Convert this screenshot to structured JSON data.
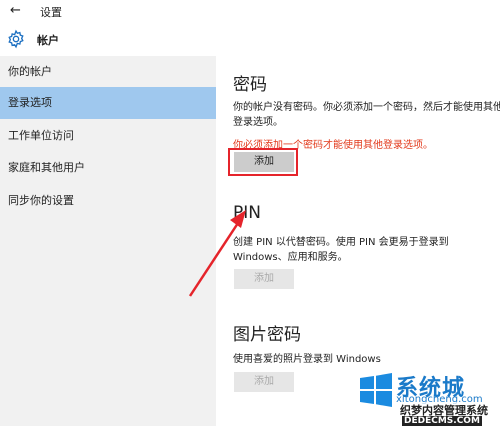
{
  "window": {
    "title": "设置",
    "back_glyph": "←"
  },
  "header": {
    "section_title": "帐户"
  },
  "sidebar": {
    "items": [
      {
        "label": "你的帐户"
      },
      {
        "label": "登录选项"
      },
      {
        "label": "工作单位访问"
      },
      {
        "label": "家庭和其他用户"
      },
      {
        "label": "同步你的设置"
      }
    ],
    "active_index": 1,
    "active_color": "#9fc8ee"
  },
  "password": {
    "heading": "密码",
    "desc": "你的帐户没有密码。你必须添加一个密码，然后才能使用其他登录选项。",
    "warning": "你必须添加一个密码才能使用其他登录选项。",
    "button": "添加"
  },
  "pin": {
    "heading": "PIN",
    "desc": "创建 PIN 以代替密码。使用 PIN 会更易于登录到 Windows、应用和服务。",
    "button": "添加"
  },
  "picture_password": {
    "heading": "图片密码",
    "desc": "使用喜爱的照片登录到 Windows",
    "button": "添加"
  },
  "watermark": {
    "brand": "系统城",
    "sub": "xitongcheng.com",
    "stamp": "织梦内容管理系统",
    "domain": "DEDECMS.COM"
  },
  "colors": {
    "warning": "#e23a1c",
    "highlight_box": "#e5242b",
    "accent": "#1b7ac9"
  }
}
